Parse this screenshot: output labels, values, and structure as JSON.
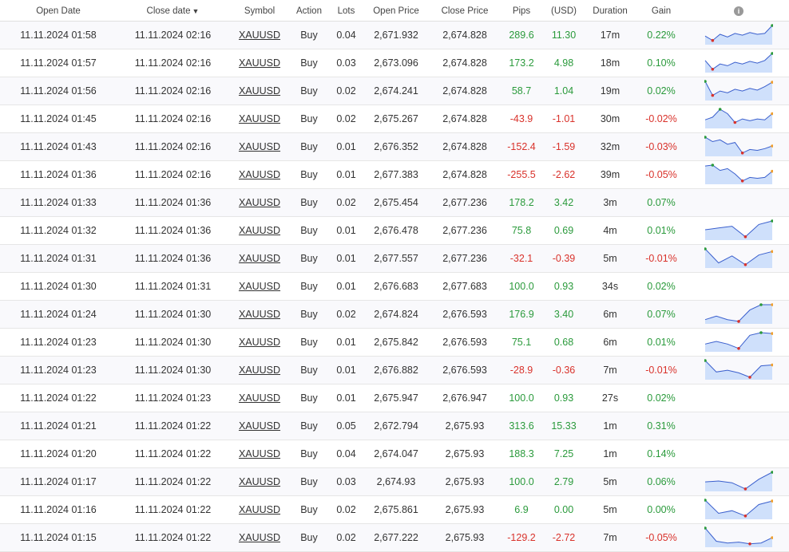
{
  "header": {
    "open_date": "Open Date",
    "close_date": "Close date",
    "sort_indicator": "▼",
    "symbol": "Symbol",
    "action": "Action",
    "lots": "Lots",
    "open_price": "Open Price",
    "close_price": "Close Price",
    "pips": "Pips",
    "usd": "(USD)",
    "duration": "Duration",
    "gain": "Gain",
    "info_icon": "info-icon"
  },
  "colors": {
    "positive": "#2a9a3b",
    "negative": "#d9322b",
    "spark_fill": "#cfe0fb",
    "spark_line": "#3a5fcd",
    "spark_high": "#2a9a3b",
    "spark_low": "#d9322b",
    "spark_end": "#f0a030"
  },
  "rows": [
    {
      "open": "11.11.2024 01:58",
      "close": "11.11.2024 02:16",
      "symbol": "XAUUSD",
      "action": "Buy",
      "lots": "0.04",
      "open_price": "2,671.932",
      "close_price": "2,674.828",
      "pips": "289.6",
      "usd": "11.30",
      "duration": "17m",
      "gain": "0.22%",
      "sign": "pos",
      "spark": [
        0.4,
        0.15,
        0.5,
        0.35,
        0.55,
        0.45,
        0.6,
        0.5,
        0.55,
        1.0
      ]
    },
    {
      "open": "11.11.2024 01:57",
      "close": "11.11.2024 02:16",
      "symbol": "XAUUSD",
      "action": "Buy",
      "lots": "0.03",
      "open_price": "2,673.096",
      "close_price": "2,674.828",
      "pips": "173.2",
      "usd": "4.98",
      "duration": "18m",
      "gain": "0.10%",
      "sign": "pos",
      "spark": [
        0.6,
        0.1,
        0.4,
        0.3,
        0.5,
        0.4,
        0.55,
        0.45,
        0.6,
        1.0
      ]
    },
    {
      "open": "11.11.2024 01:56",
      "close": "11.11.2024 02:16",
      "symbol": "XAUUSD",
      "action": "Buy",
      "lots": "0.02",
      "open_price": "2,674.241",
      "close_price": "2,674.828",
      "pips": "58.7",
      "usd": "1.04",
      "duration": "19m",
      "gain": "0.02%",
      "sign": "pos",
      "spark": [
        1.0,
        0.2,
        0.45,
        0.35,
        0.55,
        0.45,
        0.6,
        0.5,
        0.7,
        0.95
      ]
    },
    {
      "open": "11.11.2024 01:45",
      "close": "11.11.2024 02:16",
      "symbol": "XAUUSD",
      "action": "Buy",
      "lots": "0.02",
      "open_price": "2,675.267",
      "close_price": "2,674.828",
      "pips": "-43.9",
      "usd": "-1.01",
      "duration": "30m",
      "gain": "-0.02%",
      "sign": "neg",
      "spark": [
        0.4,
        0.55,
        1.0,
        0.75,
        0.25,
        0.45,
        0.35,
        0.45,
        0.4,
        0.75
      ]
    },
    {
      "open": "11.11.2024 01:43",
      "close": "11.11.2024 02:16",
      "symbol": "XAUUSD",
      "action": "Buy",
      "lots": "0.01",
      "open_price": "2,676.352",
      "close_price": "2,674.828",
      "pips": "-152.4",
      "usd": "-1.59",
      "duration": "32m",
      "gain": "-0.03%",
      "sign": "neg",
      "spark": [
        1.0,
        0.75,
        0.85,
        0.6,
        0.7,
        0.1,
        0.3,
        0.25,
        0.35,
        0.5
      ]
    },
    {
      "open": "11.11.2024 01:36",
      "close": "11.11.2024 02:16",
      "symbol": "XAUUSD",
      "action": "Buy",
      "lots": "0.01",
      "open_price": "2,677.383",
      "close_price": "2,674.828",
      "pips": "-255.5",
      "usd": "-2.62",
      "duration": "39m",
      "gain": "-0.05%",
      "sign": "neg",
      "spark": [
        0.95,
        1.0,
        0.7,
        0.8,
        0.5,
        0.1,
        0.3,
        0.25,
        0.3,
        0.65
      ]
    },
    {
      "open": "11.11.2024 01:33",
      "close": "11.11.2024 01:36",
      "symbol": "XAUUSD",
      "action": "Buy",
      "lots": "0.02",
      "open_price": "2,675.454",
      "close_price": "2,677.236",
      "pips": "178.2",
      "usd": "3.42",
      "duration": "3m",
      "gain": "0.07%",
      "sign": "pos",
      "spark": []
    },
    {
      "open": "11.11.2024 01:32",
      "close": "11.11.2024 01:36",
      "symbol": "XAUUSD",
      "action": "Buy",
      "lots": "0.01",
      "open_price": "2,676.478",
      "close_price": "2,677.236",
      "pips": "75.8",
      "usd": "0.69",
      "duration": "4m",
      "gain": "0.01%",
      "sign": "pos",
      "spark": [
        0.5,
        0.6,
        0.7,
        0.1,
        0.8,
        1.0
      ]
    },
    {
      "open": "11.11.2024 01:31",
      "close": "11.11.2024 01:36",
      "symbol": "XAUUSD",
      "action": "Buy",
      "lots": "0.01",
      "open_price": "2,677.557",
      "close_price": "2,677.236",
      "pips": "-32.1",
      "usd": "-0.39",
      "duration": "5m",
      "gain": "-0.01%",
      "sign": "neg",
      "spark": [
        1.0,
        0.2,
        0.6,
        0.1,
        0.65,
        0.85
      ]
    },
    {
      "open": "11.11.2024 01:30",
      "close": "11.11.2024 01:31",
      "symbol": "XAUUSD",
      "action": "Buy",
      "lots": "0.01",
      "open_price": "2,676.683",
      "close_price": "2,677.683",
      "pips": "100.0",
      "usd": "0.93",
      "duration": "34s",
      "gain": "0.02%",
      "sign": "pos",
      "spark": []
    },
    {
      "open": "11.11.2024 01:24",
      "close": "11.11.2024 01:30",
      "symbol": "XAUUSD",
      "action": "Buy",
      "lots": "0.02",
      "open_price": "2,674.824",
      "close_price": "2,676.593",
      "pips": "176.9",
      "usd": "3.40",
      "duration": "6m",
      "gain": "0.07%",
      "sign": "pos",
      "spark": [
        0.15,
        0.35,
        0.15,
        0.05,
        0.7,
        1.0,
        1.0
      ]
    },
    {
      "open": "11.11.2024 01:23",
      "close": "11.11.2024 01:30",
      "symbol": "XAUUSD",
      "action": "Buy",
      "lots": "0.01",
      "open_price": "2,675.842",
      "close_price": "2,676.593",
      "pips": "75.1",
      "usd": "0.68",
      "duration": "6m",
      "gain": "0.01%",
      "sign": "pos",
      "spark": [
        0.35,
        0.5,
        0.35,
        0.1,
        0.85,
        1.0,
        0.95
      ]
    },
    {
      "open": "11.11.2024 01:23",
      "close": "11.11.2024 01:30",
      "symbol": "XAUUSD",
      "action": "Buy",
      "lots": "0.01",
      "open_price": "2,676.882",
      "close_price": "2,676.593",
      "pips": "-28.9",
      "usd": "-0.36",
      "duration": "7m",
      "gain": "-0.01%",
      "sign": "neg",
      "spark": [
        1.0,
        0.35,
        0.45,
        0.3,
        0.05,
        0.7,
        0.75
      ]
    },
    {
      "open": "11.11.2024 01:22",
      "close": "11.11.2024 01:23",
      "symbol": "XAUUSD",
      "action": "Buy",
      "lots": "0.01",
      "open_price": "2,675.947",
      "close_price": "2,676.947",
      "pips": "100.0",
      "usd": "0.93",
      "duration": "27s",
      "gain": "0.02%",
      "sign": "pos",
      "spark": []
    },
    {
      "open": "11.11.2024 01:21",
      "close": "11.11.2024 01:22",
      "symbol": "XAUUSD",
      "action": "Buy",
      "lots": "0.05",
      "open_price": "2,672.794",
      "close_price": "2,675.93",
      "pips": "313.6",
      "usd": "15.33",
      "duration": "1m",
      "gain": "0.31%",
      "sign": "pos",
      "spark": []
    },
    {
      "open": "11.11.2024 01:20",
      "close": "11.11.2024 01:22",
      "symbol": "XAUUSD",
      "action": "Buy",
      "lots": "0.04",
      "open_price": "2,674.047",
      "close_price": "2,675.93",
      "pips": "188.3",
      "usd": "7.25",
      "duration": "1m",
      "gain": "0.14%",
      "sign": "pos",
      "spark": []
    },
    {
      "open": "11.11.2024 01:17",
      "close": "11.11.2024 01:22",
      "symbol": "XAUUSD",
      "action": "Buy",
      "lots": "0.03",
      "open_price": "2,674.93",
      "close_price": "2,675.93",
      "pips": "100.0",
      "usd": "2.79",
      "duration": "5m",
      "gain": "0.06%",
      "sign": "pos",
      "spark": [
        0.45,
        0.5,
        0.4,
        0.05,
        0.6,
        1.0
      ]
    },
    {
      "open": "11.11.2024 01:16",
      "close": "11.11.2024 01:22",
      "symbol": "XAUUSD",
      "action": "Buy",
      "lots": "0.02",
      "open_price": "2,675.861",
      "close_price": "2,675.93",
      "pips": "6.9",
      "usd": "0.00",
      "duration": "5m",
      "gain": "0.00%",
      "sign": "pos",
      "spark": [
        1.0,
        0.25,
        0.4,
        0.1,
        0.75,
        0.95
      ]
    },
    {
      "open": "11.11.2024 01:15",
      "close": "11.11.2024 01:22",
      "symbol": "XAUUSD",
      "action": "Buy",
      "lots": "0.02",
      "open_price": "2,677.222",
      "close_price": "2,675.93",
      "pips": "-129.2",
      "usd": "-2.72",
      "duration": "7m",
      "gain": "-0.05%",
      "sign": "neg",
      "spark": [
        1.0,
        0.25,
        0.15,
        0.2,
        0.1,
        0.15,
        0.45
      ]
    }
  ]
}
